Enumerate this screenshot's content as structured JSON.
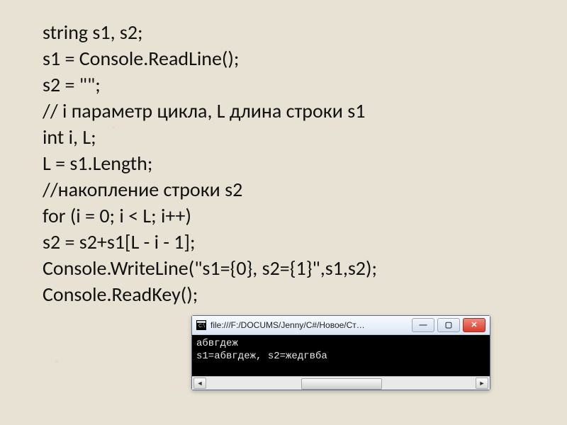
{
  "code": {
    "lines": [
      "string s1, s2;",
      "s1 = Console.ReadLine();",
      "s2 = \"\";",
      "// i параметр цикла, L длина строки s1",
      "int i, L;",
      "L = s1.Length;",
      "//накопление строки s2",
      "for (i = 0; i < L; i++)",
      "s2 = s2+s1[L - i - 1];",
      "Console.WriteLine(\"s1={0}, s2={1}\",s1,s2);",
      "Console.ReadKey();"
    ]
  },
  "console": {
    "title": "file:///F:/DOCUMS/Jenny/C#/Новое/Ст…",
    "output_lines": [
      "абвгдеж",
      "s1=абвгдеж, s2=жедгвба"
    ]
  },
  "icons": {
    "app": "console-app-icon",
    "minimize": "—",
    "maximize": "▢",
    "close": "✕",
    "left_arrow": "◄",
    "right_arrow": "►"
  }
}
